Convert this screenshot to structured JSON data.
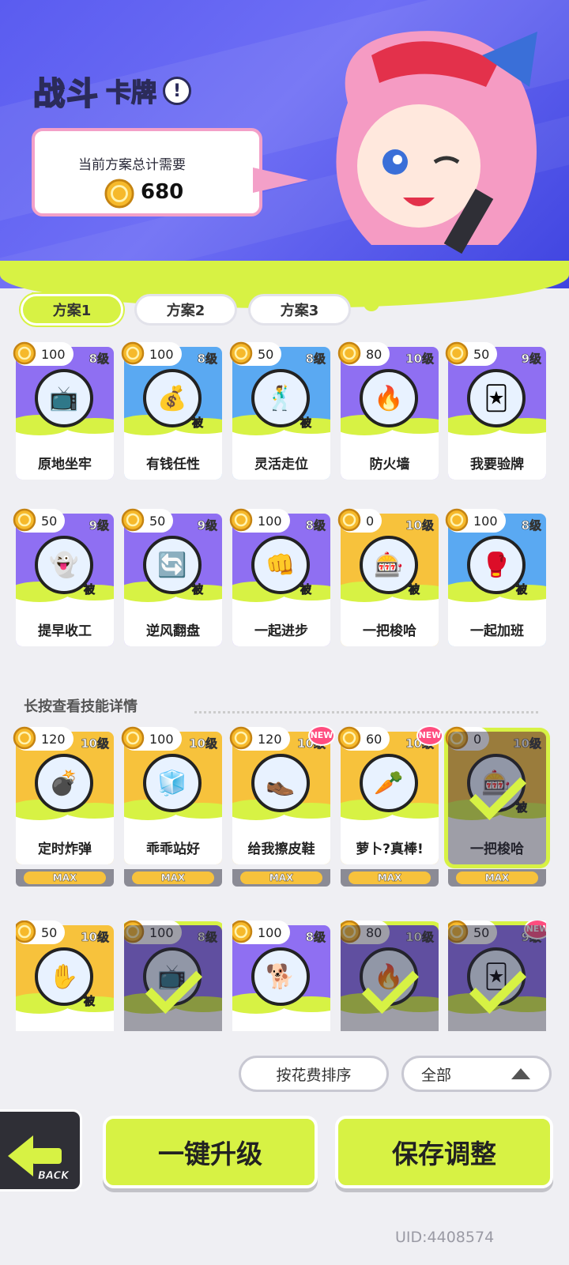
{
  "header": {
    "title_main": "战斗",
    "title_sub": "卡牌",
    "info_symbol": "!",
    "cost_label": "当前方案总计需要",
    "cost_value": "680"
  },
  "tabs": [
    {
      "label": "方案1",
      "active": true
    },
    {
      "label": "方案2",
      "active": false
    },
    {
      "label": "方案3",
      "active": false
    }
  ],
  "passive_tag": "被",
  "equipped_cards": [
    {
      "cost": "100",
      "level": "8级",
      "name": "原地坐牢",
      "color": "purple",
      "passive": false,
      "icon": "tv-robot"
    },
    {
      "cost": "100",
      "level": "8级",
      "name": "有钱任性",
      "color": "blue",
      "passive": true,
      "icon": "money-pig"
    },
    {
      "cost": "50",
      "level": "8级",
      "name": "灵活走位",
      "color": "blue",
      "passive": true,
      "icon": "dancing-kid"
    },
    {
      "cost": "80",
      "level": "10级",
      "name": "防火墙",
      "color": "purple",
      "passive": false,
      "icon": "fire-wall"
    },
    {
      "cost": "50",
      "level": "9级",
      "name": "我要验牌",
      "color": "purple",
      "passive": false,
      "icon": "cards-hand"
    },
    {
      "cost": "50",
      "level": "9级",
      "name": "提早收工",
      "color": "purple",
      "passive": true,
      "icon": "ghost"
    },
    {
      "cost": "50",
      "level": "9级",
      "name": "逆风翻盘",
      "color": "purple",
      "passive": true,
      "icon": "card-flip"
    },
    {
      "cost": "100",
      "level": "8级",
      "name": "一起进步",
      "color": "purple",
      "passive": true,
      "icon": "punch"
    },
    {
      "cost": "0",
      "level": "10级",
      "name": "一把梭哈",
      "color": "yellow",
      "passive": true,
      "icon": "slot-machine"
    },
    {
      "cost": "100",
      "level": "8级",
      "name": "一起加班",
      "color": "blue",
      "passive": true,
      "icon": "boxing-glove"
    }
  ],
  "section_title": "长按查看技能详情",
  "max_label": "MAX",
  "new_label": "NEW",
  "library_cards": [
    {
      "cost": "120",
      "level": "10级",
      "name": "定时炸弹",
      "color": "yellow",
      "passive": false,
      "max": true,
      "new": false,
      "selected": false,
      "icon": "bomb"
    },
    {
      "cost": "100",
      "level": "10级",
      "name": "乖乖站好",
      "color": "yellow",
      "passive": false,
      "max": true,
      "new": false,
      "selected": false,
      "icon": "ice-cube"
    },
    {
      "cost": "120",
      "level": "10级",
      "name": "给我擦皮鞋",
      "color": "yellow",
      "passive": false,
      "max": true,
      "new": true,
      "selected": false,
      "icon": "shoe"
    },
    {
      "cost": "60",
      "level": "10级",
      "name": "萝卜?真棒!",
      "color": "yellow",
      "passive": false,
      "max": true,
      "new": true,
      "selected": false,
      "icon": "carrot"
    },
    {
      "cost": "0",
      "level": "10级",
      "name": "一把梭哈",
      "color": "yellow",
      "passive": true,
      "max": true,
      "new": false,
      "selected": true,
      "icon": "slot-machine"
    },
    {
      "cost": "50",
      "level": "10级",
      "name": "",
      "color": "yellow",
      "passive": true,
      "max": false,
      "new": false,
      "selected": false,
      "icon": "flame-hand"
    },
    {
      "cost": "100",
      "level": "8级",
      "name": "",
      "color": "purple",
      "passive": false,
      "max": false,
      "new": false,
      "selected": true,
      "icon": "tv-robot"
    },
    {
      "cost": "100",
      "level": "8级",
      "name": "",
      "color": "purple",
      "passive": false,
      "max": false,
      "new": false,
      "selected": false,
      "icon": "golden-dog"
    },
    {
      "cost": "80",
      "level": "10级",
      "name": "",
      "color": "purple",
      "passive": false,
      "max": false,
      "new": false,
      "selected": true,
      "icon": "fire-wall"
    },
    {
      "cost": "50",
      "level": "9级",
      "name": "",
      "color": "purple",
      "passive": false,
      "max": false,
      "new": true,
      "selected": true,
      "icon": "cards-hand"
    }
  ],
  "controls": {
    "sort_label": "按花费排序",
    "filter_label": "全部",
    "back_label": "BACK",
    "upgrade_label": "一键升级",
    "save_label": "保存调整"
  },
  "uid": "UID:4408574",
  "colors": {
    "lime": "#d7f244",
    "purple": "#8f6ff2",
    "blue": "#5aa9f2",
    "yellow": "#f7c23c",
    "banner": "#5a5cf0"
  }
}
